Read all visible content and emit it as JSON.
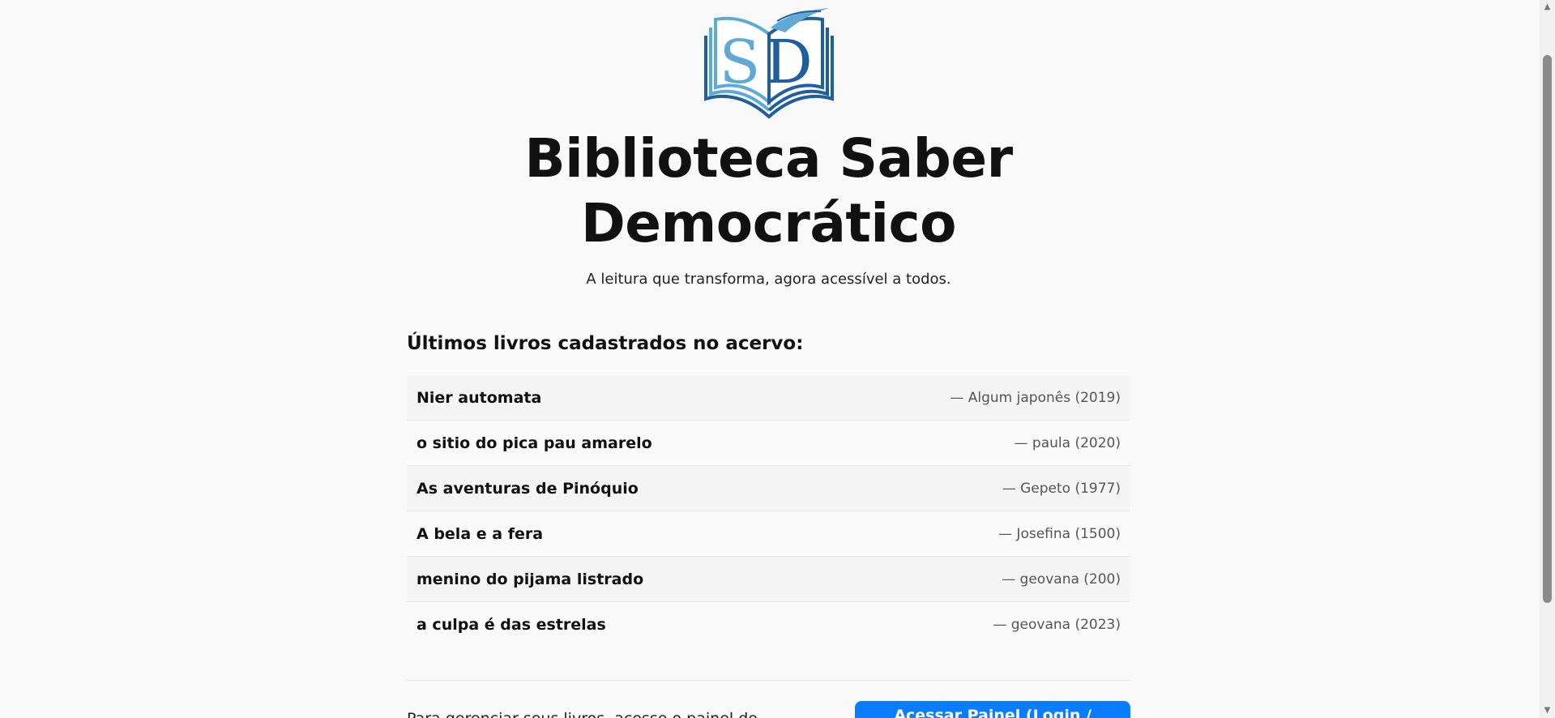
{
  "header": {
    "title": "Biblioteca Saber Democrático",
    "tagline": "A leitura que transforma, agora acessível a todos.",
    "logo_icon": "open-book-sd-logo-icon",
    "logo_letters": "SD"
  },
  "books_section": {
    "heading": "Últimos livros cadastrados no acervo:",
    "books": [
      {
        "title": "Nier automata",
        "meta": "— Algum japonês (2019)"
      },
      {
        "title": "o sitio do pica pau amarelo",
        "meta": "— paula (2020)"
      },
      {
        "title": "As aventuras de Pinóquio",
        "meta": "— Gepeto (1977)"
      },
      {
        "title": "A bela e a fera",
        "meta": "— Josefina (1500)"
      },
      {
        "title": "menino do pijama listrado",
        "meta": "— geovana (200)"
      },
      {
        "title": "a culpa é das estrelas",
        "meta": "— geovana (2023)"
      }
    ]
  },
  "admin": {
    "text": "Para gerenciar seus livros, acesse o painel de administrador:",
    "button_label": "Acessar Painel (Login / Registro)"
  },
  "colors": {
    "accent": "#0a7cff",
    "logo_dark": "#1f5f9e",
    "logo_light": "#5fa9d6"
  },
  "icons": {
    "scroll_up": "triangle-up-icon",
    "scroll_down": "triangle-down-icon"
  }
}
